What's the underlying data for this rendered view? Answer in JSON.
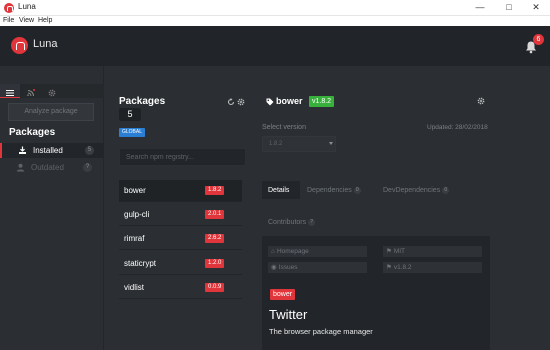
{
  "window": {
    "title": "Luna"
  },
  "menu": [
    "File",
    "View",
    "Help"
  ],
  "app": {
    "name": "Luna",
    "notification_count": "6"
  },
  "sidebar": {
    "analyze_label": "Analyze package",
    "heading": "Packages",
    "items": [
      {
        "label": "Installed",
        "count": "5",
        "icon": "download-icon"
      },
      {
        "label": "Outdated",
        "count": "?",
        "icon": "user-icon"
      }
    ]
  },
  "packages": {
    "title": "Packages",
    "count": "5",
    "scope": "GLOBAL",
    "search_placeholder": "Search npm registry...",
    "list": [
      {
        "name": "bower",
        "version": "1.8.2"
      },
      {
        "name": "gulp-cli",
        "version": "2.0.1"
      },
      {
        "name": "rimraf",
        "version": "2.6.2"
      },
      {
        "name": "staticrypt",
        "version": "1.2.0"
      },
      {
        "name": "vidlist",
        "version": "0.0.9"
      }
    ]
  },
  "details": {
    "name": "bower",
    "version": "v1.8.2",
    "select_label": "Select version",
    "updated": "Updated: 28/02/2018",
    "selected_version": "1.8.2",
    "tabs": [
      {
        "label": "Details",
        "count": ""
      },
      {
        "label": "Dependencies",
        "count": "0"
      },
      {
        "label": "DevDependencies",
        "count": "0"
      },
      {
        "label": "Contributors",
        "count": "?"
      }
    ],
    "chips": {
      "homepage": "Homepage",
      "license": "MIT",
      "issues": "Issues",
      "version": "v1.8.2"
    },
    "name_tag": "bower",
    "author": "Twitter",
    "description": "The browser package manager"
  },
  "colors": {
    "accent": "#e0353a",
    "header_bg": "#212428",
    "panel_bg": "#2b2f33",
    "global_badge": "#2a7fd4",
    "version_badge": "#38b03c"
  }
}
